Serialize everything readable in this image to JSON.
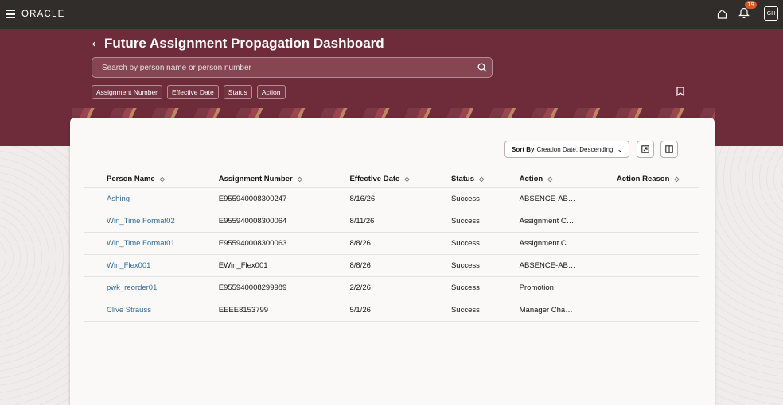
{
  "app": {
    "logo": "ORACLE",
    "notification_count": "19",
    "user_initials": "GH"
  },
  "page": {
    "title": "Future Assignment Propagation Dashboard",
    "search_placeholder": "Search by person name or person number",
    "filters": [
      "Assignment Number",
      "Effective Date",
      "Status",
      "Action"
    ]
  },
  "toolbar": {
    "sort_label": "Sort By",
    "sort_value": "Creation Date, Descending"
  },
  "table": {
    "columns": [
      "Person Name",
      "Assignment Number",
      "Effective Date",
      "Status",
      "Action",
      "Action Reason"
    ],
    "rows": [
      [
        "Ashing",
        "E955940008300247",
        "8/16/26",
        "Success",
        "ABSENCE-AB…",
        ""
      ],
      [
        "Win_Time Format02",
        "E955940008300064",
        "8/11/26",
        "Success",
        "Assignment C…",
        ""
      ],
      [
        "Win_Time Format01",
        "E955940008300063",
        "8/8/26",
        "Success",
        "Assignment C…",
        ""
      ],
      [
        "Win_Flex001",
        "EWin_Flex001",
        "8/8/26",
        "Success",
        "ABSENCE-AB…",
        ""
      ],
      [
        "pwk_reorder01",
        "E955940008299989",
        "2/2/26",
        "Success",
        "Promotion",
        ""
      ],
      [
        "Clive Strauss",
        "EEEE8153799",
        "5/1/26",
        "Success",
        "Manager Cha…",
        ""
      ]
    ]
  },
  "colors": {
    "hero": "#6e2c3a",
    "topbar": "#312d2a",
    "link": "#2e6d99"
  }
}
